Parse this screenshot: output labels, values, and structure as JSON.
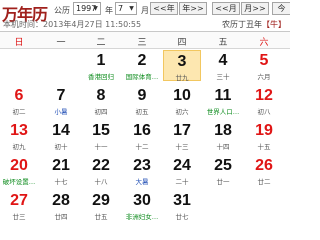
{
  "header": {
    "logo": "万年历",
    "label_calendar": "公历",
    "year_value": "1997",
    "label_year": "年",
    "month_value": "7",
    "label_month": "月",
    "nav_prev_year": "<<年",
    "nav_next_year": "年>>",
    "nav_prev_month": "<<月",
    "nav_next_month": "月>>",
    "nav_today": "今",
    "current_time": "本机时间：2013年4月27日 11:50:55",
    "lunar_info": "农历丁丑年",
    "zodiac": "【牛】"
  },
  "weekdays": [
    "日",
    "一",
    "二",
    "三",
    "四",
    "五",
    "六"
  ],
  "days": [
    {
      "day": "1",
      "sub": "香港回归",
      "sub_color": "green"
    },
    {
      "day": "2",
      "sub": "国际体育…",
      "sub_color": "green"
    },
    {
      "day": "3",
      "sub": "廿九",
      "sub_color": "gray",
      "today": true
    },
    {
      "day": "4",
      "sub": "三十",
      "sub_color": "gray"
    },
    {
      "day": "5",
      "sub": "六月",
      "sub_color": "gray",
      "weekend": true
    },
    {
      "day": "6",
      "sub": "初二",
      "sub_color": "gray",
      "weekend": true
    },
    {
      "day": "7",
      "sub": "小暑",
      "sub_color": "blue"
    },
    {
      "day": "8",
      "sub": "初四",
      "sub_color": "gray"
    },
    {
      "day": "9",
      "sub": "初五",
      "sub_color": "gray"
    },
    {
      "day": "10",
      "sub": "初六",
      "sub_color": "gray"
    },
    {
      "day": "11",
      "sub": "世界人口…",
      "sub_color": "green"
    },
    {
      "day": "12",
      "sub": "初八",
      "sub_color": "gray",
      "weekend": true
    },
    {
      "day": "13",
      "sub": "初九",
      "sub_color": "gray",
      "weekend": true
    },
    {
      "day": "14",
      "sub": "初十",
      "sub_color": "gray"
    },
    {
      "day": "15",
      "sub": "十一",
      "sub_color": "gray"
    },
    {
      "day": "16",
      "sub": "十二",
      "sub_color": "gray"
    },
    {
      "day": "17",
      "sub": "十三",
      "sub_color": "gray"
    },
    {
      "day": "18",
      "sub": "十四",
      "sub_color": "gray"
    },
    {
      "day": "19",
      "sub": "十五",
      "sub_color": "gray",
      "weekend": true
    },
    {
      "day": "20",
      "sub": "破坏设置…",
      "sub_color": "green",
      "weekend": true
    },
    {
      "day": "21",
      "sub": "十七",
      "sub_color": "gray"
    },
    {
      "day": "22",
      "sub": "十八",
      "sub_color": "gray"
    },
    {
      "day": "23",
      "sub": "大暑",
      "sub_color": "blue"
    },
    {
      "day": "24",
      "sub": "二十",
      "sub_color": "gray"
    },
    {
      "day": "25",
      "sub": "廿一",
      "sub_color": "gray"
    },
    {
      "day": "26",
      "sub": "廿二",
      "sub_color": "gray",
      "weekend": true
    },
    {
      "day": "27",
      "sub": "廿三",
      "sub_color": "gray",
      "weekend": true
    },
    {
      "day": "28",
      "sub": "廿四",
      "sub_color": "gray"
    },
    {
      "day": "29",
      "sub": "廿五",
      "sub_color": "gray"
    },
    {
      "day": "30",
      "sub": "非洲妇女…",
      "sub_color": "green"
    },
    {
      "day": "31",
      "sub": "廿七",
      "sub_color": "gray"
    }
  ],
  "colors": {
    "logo": "#a0201c",
    "weekend": "#e01515",
    "holiday": "#0a8a1a",
    "solar_term": "#1f4db5",
    "today_bg": "#fde7b0"
  }
}
